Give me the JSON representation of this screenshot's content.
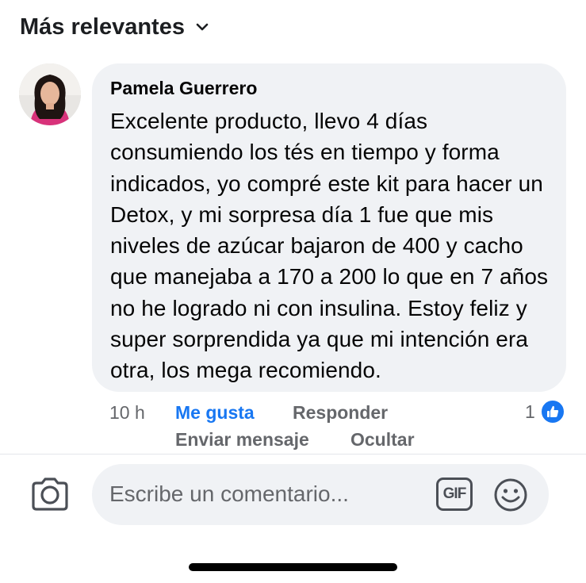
{
  "header": {
    "sort_label": "Más relevantes",
    "chevron_icon": "chevron-down-icon"
  },
  "comment": {
    "author": "Pamela Guerrero",
    "text": "Excelente producto, llevo 4 días consumiendo los tés en tiempo y forma indicados, yo compré este kit para hacer un Detox, y mi sorpresa día 1 fue que mis niveles de azúcar bajaron de 400 y cacho que manejaba a 170 a 200 lo que en 7 años no he logrado ni con insulina. Estoy feliz y super sorprendida ya que mi intención era otra, los mega recomiendo.",
    "time": "10 h",
    "actions": {
      "like": "Me gusta",
      "reply": "Responder",
      "send_message": "Enviar mensaje",
      "hide": "Ocultar"
    },
    "reaction_count": "1",
    "reaction_icon": "thumbs-up-icon"
  },
  "composer": {
    "placeholder": "Escribe un comentario...",
    "gif_label": "GIF",
    "camera_icon": "camera-icon",
    "emoji_icon": "smiley-icon"
  },
  "colors": {
    "accent": "#1877f2",
    "bubble": "#f0f2f5",
    "secondary_text": "#65676b"
  }
}
